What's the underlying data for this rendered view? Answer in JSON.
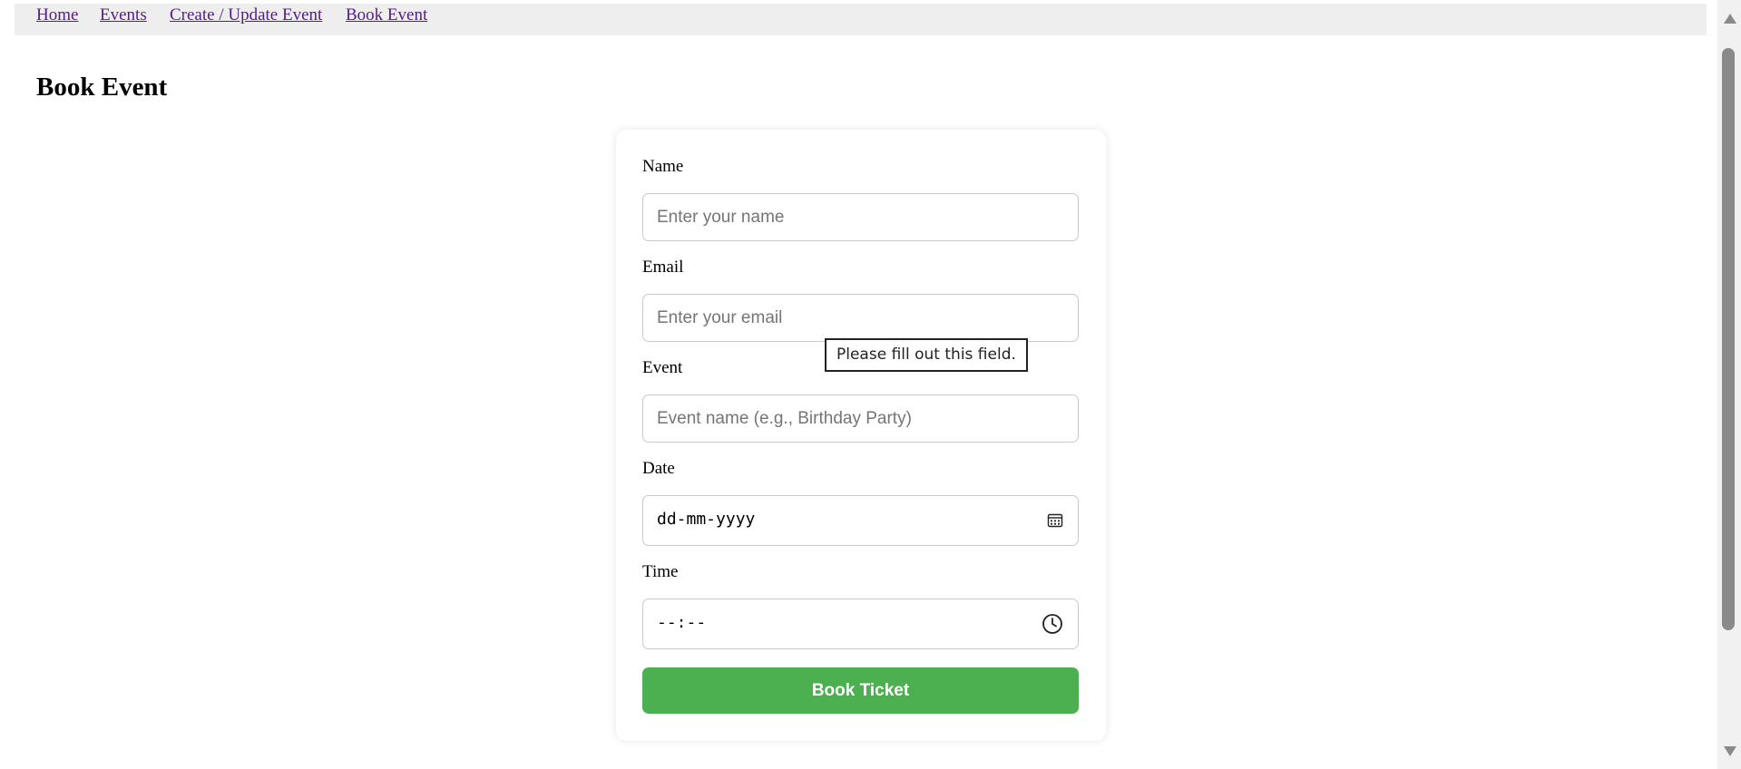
{
  "nav": {
    "links": [
      "Home",
      "Events",
      "Create / Update Event",
      "Book Event"
    ]
  },
  "page": {
    "title": "Book Event"
  },
  "form": {
    "name_label": "Name",
    "name_placeholder": "Enter your name",
    "email_label": "Email",
    "email_placeholder": "Enter your email",
    "event_label": "Event",
    "event_placeholder": "Event name (e.g., Birthday Party)",
    "date_label": "Date",
    "date_value": "dd-mm-yyyy",
    "date_icon": "calendar-icon",
    "time_label": "Time",
    "time_value": "--:--",
    "time_icon": "clock-icon",
    "submit_label": "Book Ticket"
  },
  "validation": {
    "message": "Please fill out this field."
  },
  "colors": {
    "link": "#551a8b",
    "nav_background": "#eeeeee",
    "submit_button": "#4caf50",
    "submit_text": "#ffffff"
  }
}
